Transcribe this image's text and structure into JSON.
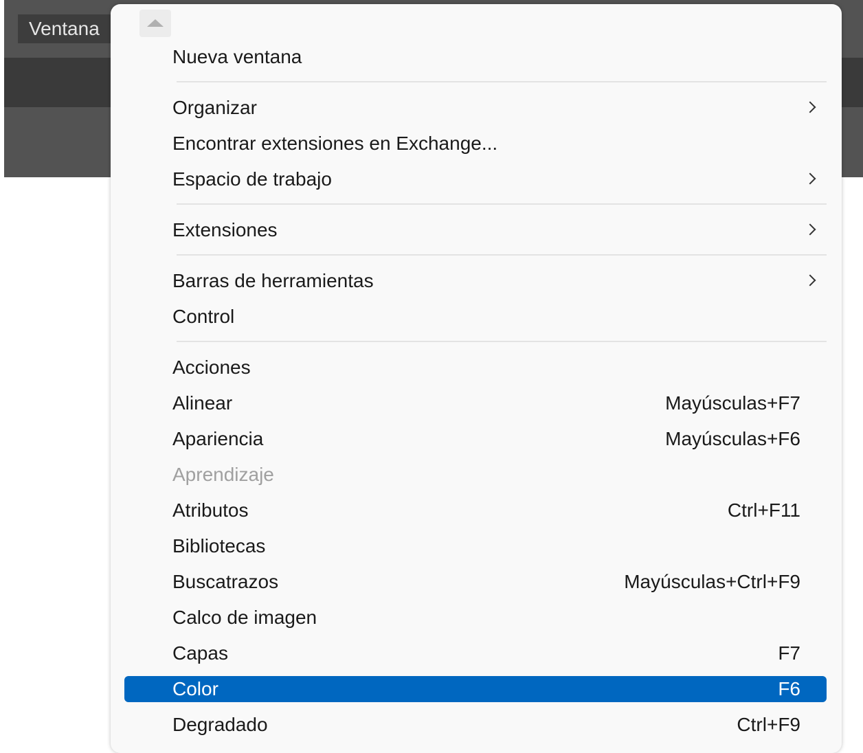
{
  "menubar": {
    "active_menu": "Ventana"
  },
  "menu": {
    "items": [
      {
        "label": "Nueva ventana"
      },
      {
        "label": "Organizar",
        "submenu": true
      },
      {
        "label": "Encontrar extensiones en Exchange..."
      },
      {
        "label": "Espacio de trabajo",
        "submenu": true
      },
      {
        "label": "Extensiones",
        "submenu": true
      },
      {
        "label": "Barras de herramientas",
        "submenu": true
      },
      {
        "label": "Control"
      },
      {
        "label": "Acciones"
      },
      {
        "label": "Alinear",
        "shortcut": "Mayúsculas+F7"
      },
      {
        "label": "Apariencia",
        "shortcut": "Mayúsculas+F6"
      },
      {
        "label": "Aprendizaje",
        "disabled": true
      },
      {
        "label": "Atributos",
        "shortcut": "Ctrl+F11"
      },
      {
        "label": "Bibliotecas"
      },
      {
        "label": "Buscatrazos",
        "shortcut": "Mayúsculas+Ctrl+F9"
      },
      {
        "label": "Calco de imagen"
      },
      {
        "label": "Capas",
        "shortcut": "F7"
      },
      {
        "label": "Color",
        "shortcut": "F6",
        "selected": true
      },
      {
        "label": "Degradado",
        "shortcut": "Ctrl+F9"
      }
    ]
  },
  "colors": {
    "selection": "#0067c0",
    "menubar": "#535353",
    "menu_background": "#f9f9f9"
  }
}
